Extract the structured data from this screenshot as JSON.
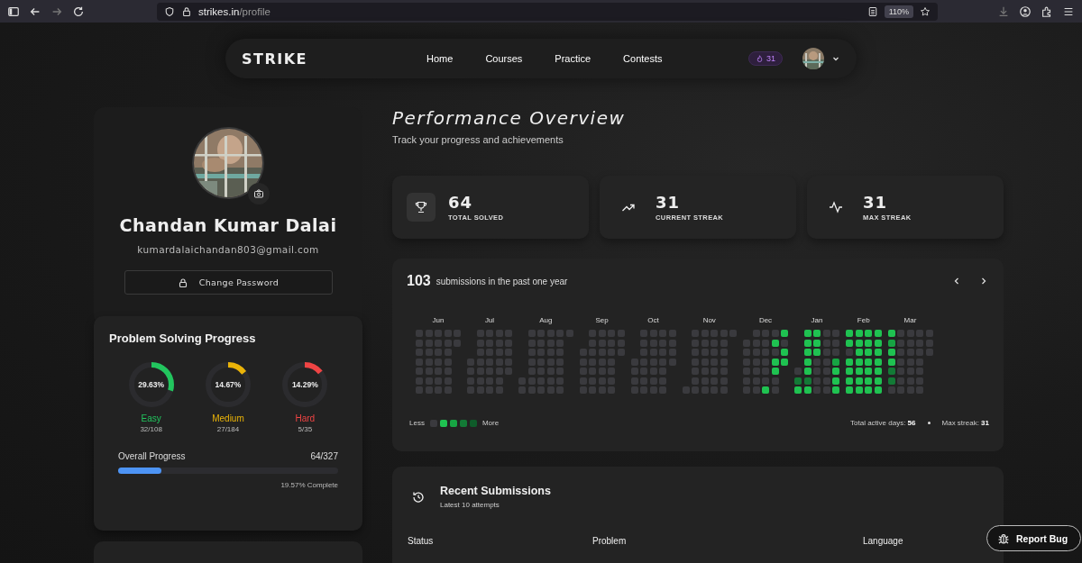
{
  "browser": {
    "url_host": "strikes.in",
    "url_path": "/profile",
    "zoom": "110%"
  },
  "navbar": {
    "logo": "STRIKE",
    "links": [
      {
        "label": "Home"
      },
      {
        "label": "Courses"
      },
      {
        "label": "Practice"
      },
      {
        "label": "Contests"
      }
    ],
    "streak_badge": "31"
  },
  "profile": {
    "name": "Chandan Kumar Dalai",
    "email": "kumardalaichandan803@gmail.com",
    "change_password": "Change Password"
  },
  "progress_card": {
    "title": "Problem Solving Progress",
    "difficulties": [
      {
        "kind": "easy",
        "percent": "29.63%",
        "label": "Easy",
        "count": "32/108"
      },
      {
        "kind": "medium",
        "percent": "14.67%",
        "label": "Medium",
        "count": "27/184"
      },
      {
        "kind": "hard",
        "percent": "14.29%",
        "label": "Hard",
        "count": "5/35"
      }
    ],
    "overall": {
      "label": "Overall Progress",
      "count": "64/327",
      "level": 0.1957,
      "caption": "19.57% Complete"
    }
  },
  "overview": {
    "title": "Performance Overview",
    "subtitle": "Track your progress and achievements"
  },
  "stats": [
    {
      "kind": "trophy",
      "value": "64",
      "label": "TOTAL SOLVED"
    },
    {
      "kind": "trend",
      "value": "31",
      "label": "CURRENT STREAK"
    },
    {
      "kind": "pulse",
      "value": "31",
      "label": "MAX STREAK"
    }
  ],
  "heatmap": {
    "count": "103",
    "caption": "submissions in the past one year",
    "months": [
      {
        "label": "Jun"
      },
      {
        "label": "Jul"
      },
      {
        "label": "Aug"
      },
      {
        "label": "Sep"
      },
      {
        "label": "Oct"
      },
      {
        "label": "Nov"
      },
      {
        "label": "Dec"
      },
      {
        "label": "Jan"
      },
      {
        "label": "Feb"
      },
      {
        "label": "Mar"
      }
    ],
    "legend_less": "Less",
    "legend_more": "More",
    "active_days_label": "Total active days:",
    "active_days": "56",
    "max_streak_label": "Max streak:",
    "max_streak": "31"
  },
  "recent": {
    "title": "Recent Submissions",
    "subtitle": "Latest 10 attempts",
    "columns": [
      "Status",
      "Problem",
      "Language"
    ]
  },
  "report_bug": "Report Bug"
}
